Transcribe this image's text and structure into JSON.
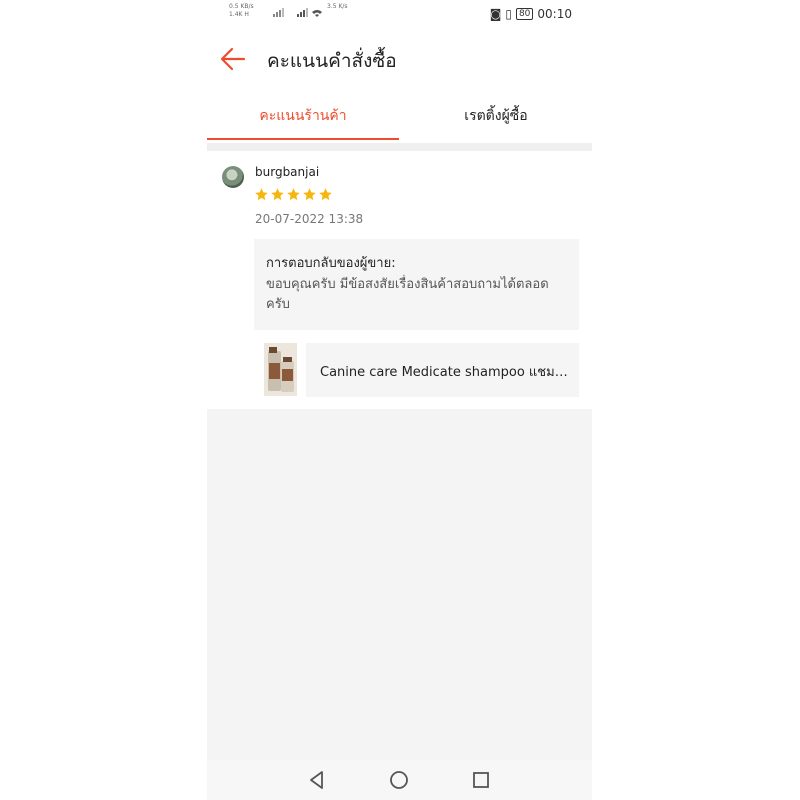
{
  "status_bar": {
    "net_line1": "0.5 KB/s",
    "net_line2": "1.4K H",
    "speed": "3.5 K/s",
    "battery": "80",
    "time": "00:10"
  },
  "header": {
    "title": "คะแนนคำสั่งซื้อ"
  },
  "tabs": [
    {
      "label": "คะแนนร้านค้า",
      "active": true
    },
    {
      "label": "เรตติ้งผู้ซื้อ",
      "active": false
    }
  ],
  "review": {
    "username": "burgbanjai",
    "rating": 5,
    "date": "20-07-2022 13:38",
    "seller_reply_title": "การตอบกลับของผู้ขาย:",
    "seller_reply_text": "ขอบคุณครับ มีข้อสงสัยเรื่องสินค้าสอบถามได้ตลอดครับ",
    "product_name": "Canine care Medicate shampoo แชมพูสุนัข"
  },
  "colors": {
    "accent": "#ee4d2d",
    "star": "#f6b60b"
  }
}
